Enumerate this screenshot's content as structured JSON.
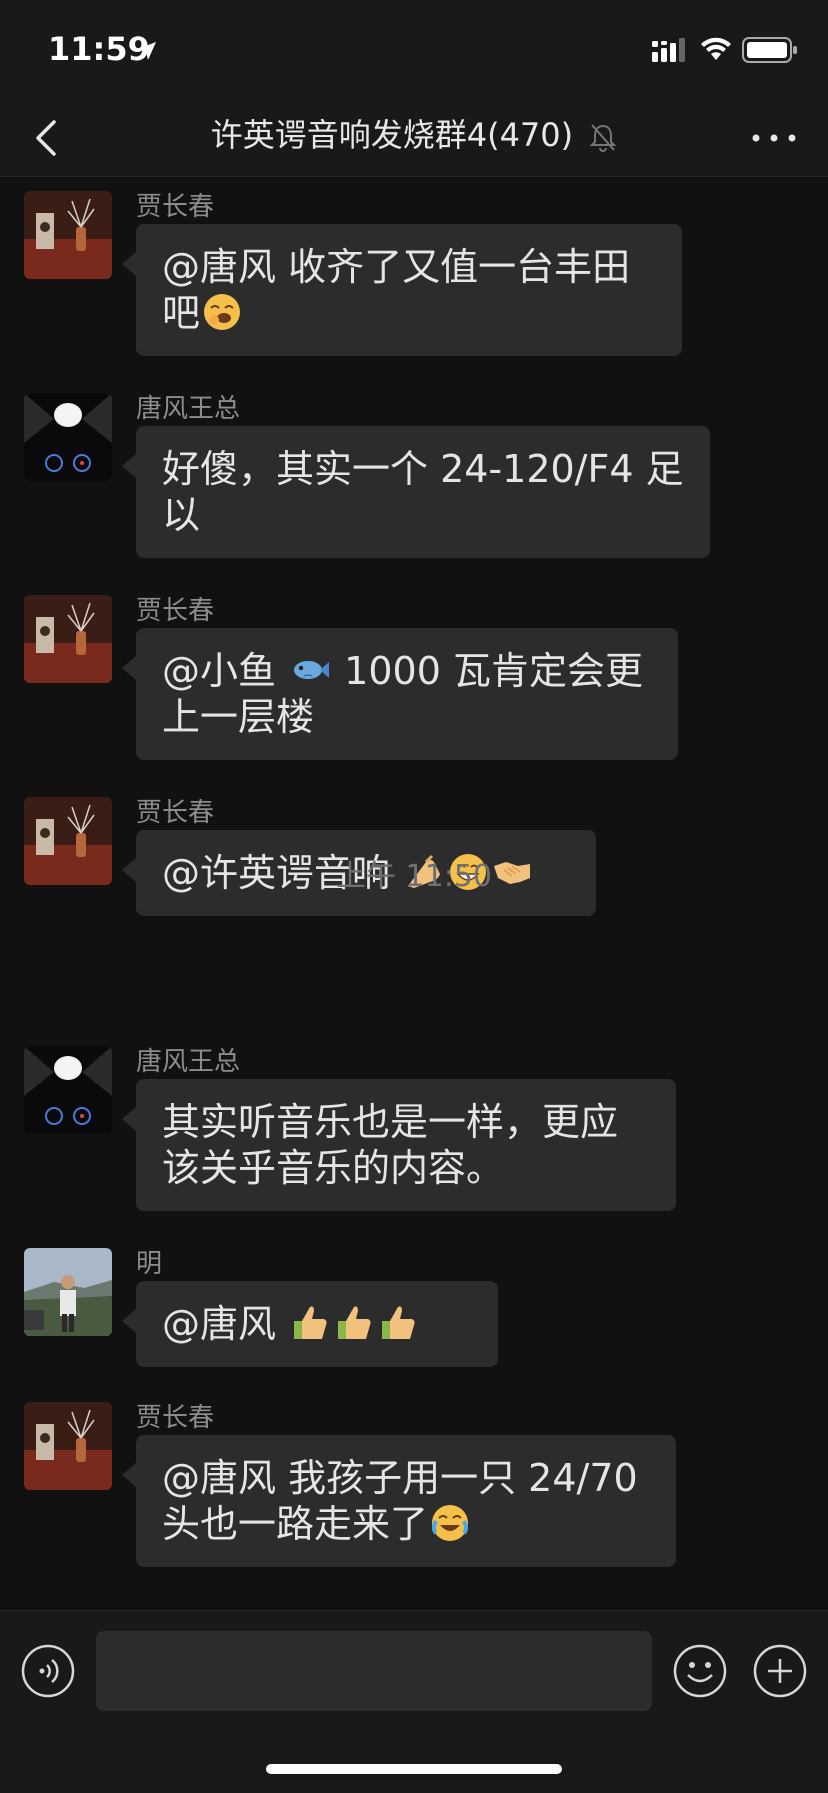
{
  "status_bar": {
    "time": "11:59"
  },
  "header": {
    "title": "许英谔音响发烧群",
    "count": "4(470)"
  },
  "messages": [
    {
      "sender": "贾长春",
      "avatar": "speaker-vase-photo",
      "text": "@唐风 收齐了又值一台丰田吧",
      "line2": "吧",
      "emojis": [
        "yawn-emoji"
      ]
    },
    {
      "sender": "唐风王总",
      "avatar": "car-dashboard-photo",
      "text": "好傻，其实一个 24-120/F4 足",
      "line2": "以"
    },
    {
      "sender": "贾长春",
      "avatar": "speaker-vase-photo",
      "text": "@小鱼",
      "fish": "fish-emoji",
      "text_after": " 1000 瓦肯定会更",
      "line2": "上一层楼"
    },
    {
      "sender": "贾长春",
      "avatar": "speaker-vase-photo",
      "text": "@许英谔音响 ",
      "emojis": [
        "pinch-hand-emoji",
        "grin-emoji",
        "handshake-emoji"
      ]
    },
    {
      "sender": "唐风王总",
      "avatar": "car-dashboard-photo",
      "text": "其实听音乐也是一样，更应",
      "line2": "该关乎音乐的内容。"
    },
    {
      "sender": "明",
      "avatar": "person-outdoor-photo",
      "text": "@唐风 ",
      "emojis": [
        "thumbs-up-emoji",
        "thumbs-up-emoji",
        "thumbs-up-emoji"
      ]
    },
    {
      "sender": "贾长春",
      "avatar": "speaker-vase-photo",
      "text": "@唐风 我孩子用一只 24/70",
      "line2": "头也一路走来了",
      "emojis": [
        "tears-of-joy-emoji"
      ]
    }
  ],
  "timestamp": "上午 11:50",
  "line1": {
    "m0": "@唐风 收齐了又值一台丰田",
    "m1": "好傻，其实一个 24-120/F4 足",
    "m2a": "@小鱼 ",
    "m2b": " 1000 瓦肯定会更",
    "m3": "@许英谔音响 ",
    "m4": "其实听音乐也是一样，更应",
    "m5": "@唐风 ",
    "m6": "@唐风 我孩子用一只 24/70"
  },
  "line2": {
    "m0": "吧",
    "m1": "以",
    "m2": "上一层楼",
    "m4": "该关乎音乐的内容。",
    "m6": "头也一路走来了"
  },
  "colors": {
    "background": "#111111",
    "bar": "#191919",
    "bubble": "#2c2c2c",
    "text": "#e5e5e5",
    "sender": "#8c8c8c"
  }
}
